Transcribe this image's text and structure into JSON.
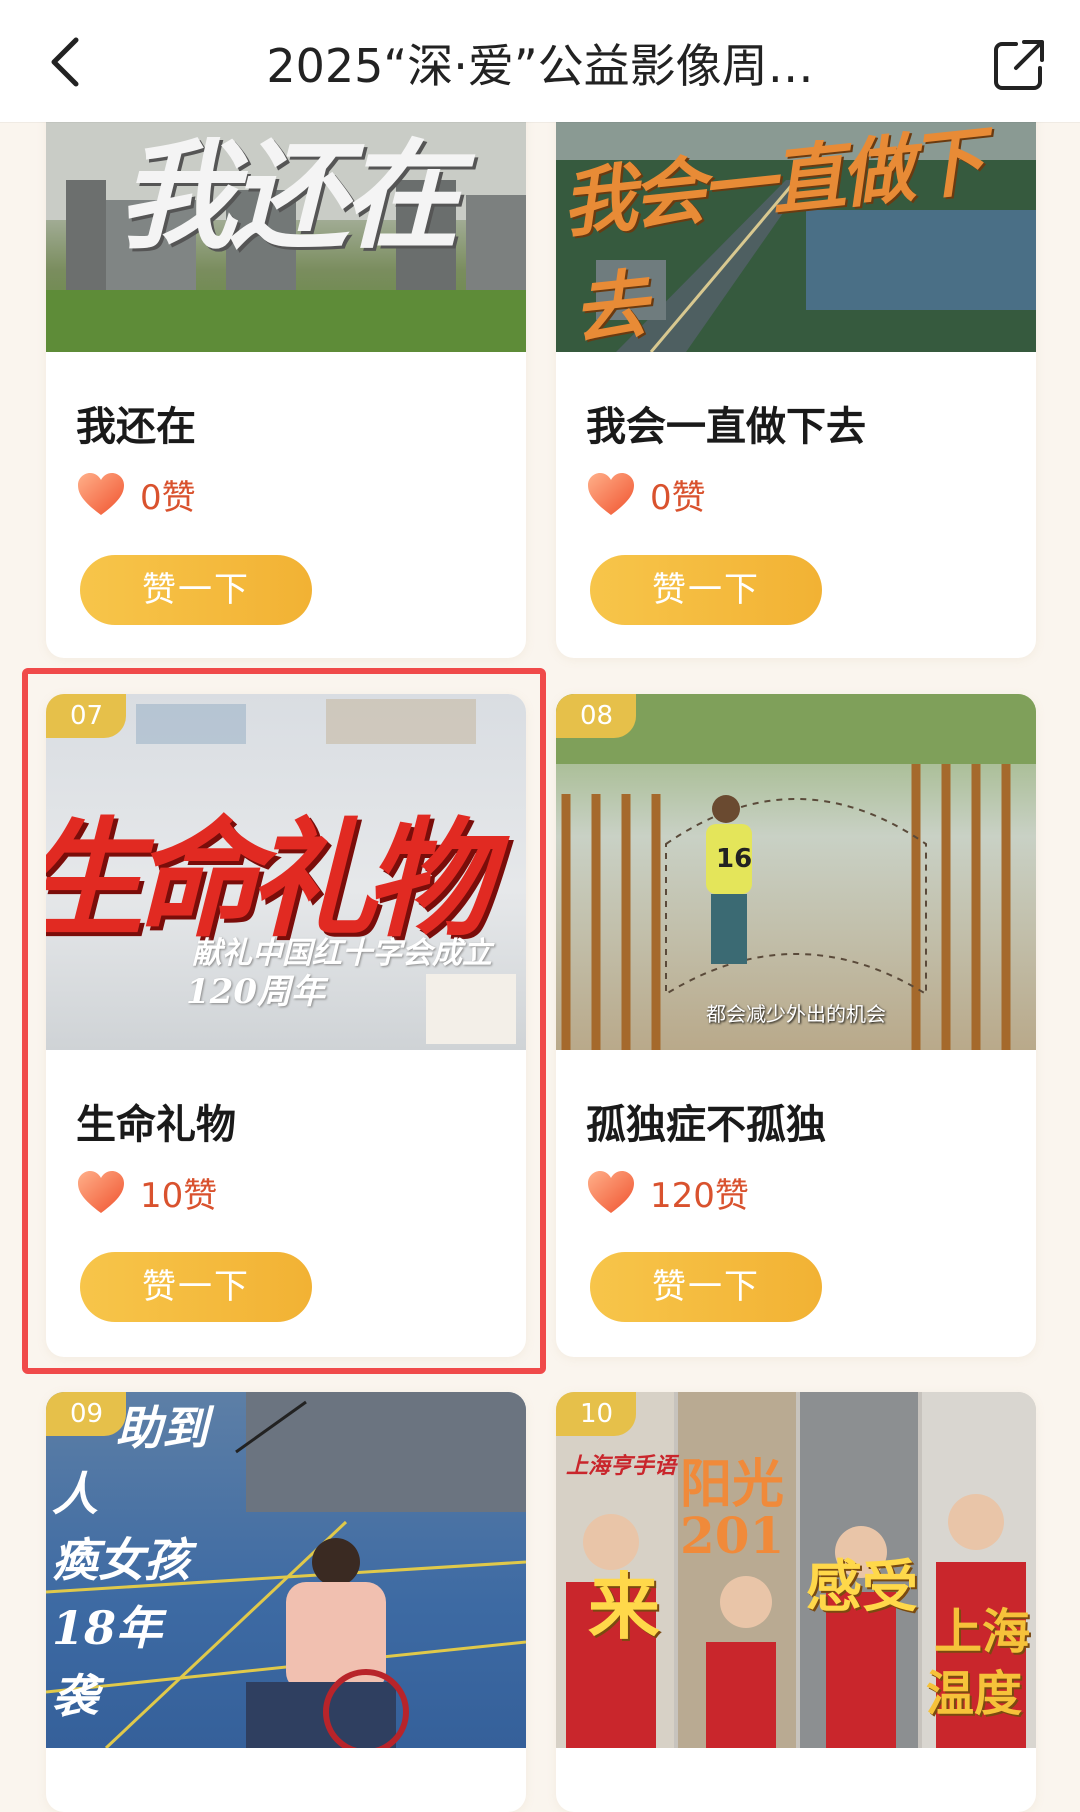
{
  "header": {
    "title": "2025“深·爱”公益影像周…"
  },
  "icons": {
    "back": "chevron-left-icon",
    "share": "share-external-icon",
    "heart": "heart-icon"
  },
  "colors": {
    "accent_button": "#f2b234",
    "likes_text": "#d9522e",
    "badge": "#e6c04a",
    "highlight": "#f04a4a"
  },
  "cards": [
    {
      "title": "我还在",
      "likes": "0赞",
      "button": "赞一下",
      "thumb_text": "我还在"
    },
    {
      "title": "我会一直做下去",
      "likes": "0赞",
      "button": "赞一下",
      "thumb_text": "我会一直做下去"
    },
    {
      "number": "07",
      "title": "生命礼物",
      "likes": "10赞",
      "button": "赞一下",
      "thumb_text": "生命礼物",
      "thumb_sub": "献礼中国红十字会成立",
      "thumb_sub2": "120周年"
    },
    {
      "number": "08",
      "title": "孤独症不孤独",
      "likes": "120赞",
      "button": "赞一下",
      "thumb_caption": "都会减少外出的机会",
      "thumb_jersey": "16"
    },
    {
      "number": "09",
      "thumb_lines": [
        "助到",
        "人",
        "瘓女孩",
        "18年",
        "袭"
      ]
    },
    {
      "number": "10",
      "thumb_sign": "上海亨手语",
      "thumb_words": [
        "来",
        "阳光",
        "201",
        "感受",
        "上海",
        "温度"
      ]
    }
  ]
}
